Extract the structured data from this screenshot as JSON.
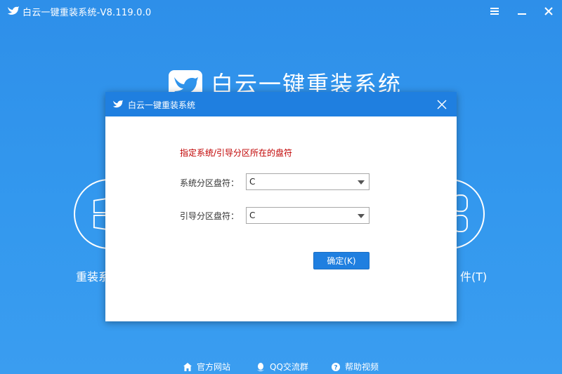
{
  "window": {
    "title": "白云一键重装系统-V8.119.0.0"
  },
  "main": {
    "logo_text": "白云一键重装系统",
    "left_label": "重装系",
    "right_label": "件(T)"
  },
  "footer": {
    "items": [
      {
        "label": "官方网站",
        "icon": "home-icon"
      },
      {
        "label": "QQ交流群",
        "icon": "qq-icon"
      },
      {
        "label": "帮助视频",
        "icon": "help-icon"
      }
    ]
  },
  "dialog": {
    "title": "白云一键重装系统",
    "hint": "指定系统/引导分区所在的盘符",
    "system_label": "系统分区盘符：",
    "system_value": "C",
    "boot_label": "引导分区盘符：",
    "boot_value": "C",
    "ok_label": "确定(K)"
  },
  "colors": {
    "background": "#2f94ec",
    "dialog_header": "#1f7fe0",
    "hint": "#c00000",
    "button": "#1f7fe0"
  }
}
